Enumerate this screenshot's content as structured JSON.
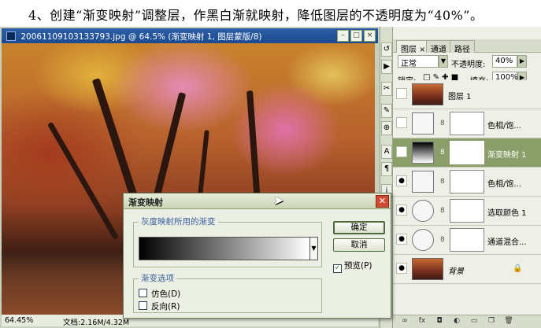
{
  "caption": "4、创建“渐变映射”调整层，作黑白渐就映射，降低图层的不透明度为“40%”。",
  "document": {
    "title": "20061109103133793.jpg @ 64.5% (渐变映射 1, 图层蒙版/8)",
    "zoom": "64.45%",
    "doc_size": "文档:2.16M/4.32M"
  },
  "layers_panel": {
    "tabs": [
      "图层",
      "通道",
      "路径"
    ],
    "blend_mode": "正常",
    "opacity_label": "不透明度:",
    "opacity_value": "40%",
    "lock_label": "锁定:",
    "fill_label": "填充:",
    "fill_value": "100%",
    "layers": [
      {
        "name": "图层 1",
        "kind": "photo",
        "visible": false,
        "selected": false
      },
      {
        "name": "色相/饱...",
        "kind": "adjust",
        "visible": false,
        "selected": false
      },
      {
        "name": "渐变映射 1",
        "kind": "gradient",
        "visible": true,
        "selected": true
      },
      {
        "name": "色相/饱...",
        "kind": "adjust",
        "visible": true,
        "selected": false
      },
      {
        "name": "选取颜色 1",
        "kind": "adjust",
        "visible": true,
        "selected": false
      },
      {
        "name": "通道混合...",
        "kind": "adjust",
        "visible": true,
        "selected": false
      },
      {
        "name": "背景",
        "kind": "photo",
        "visible": true,
        "selected": false
      }
    ]
  },
  "dialog": {
    "title": "渐变映射",
    "group1_title": "灰度映射所用的渐变",
    "group2_title": "渐变选项",
    "dither_label": "仿色(D)",
    "reverse_label": "反向(R)",
    "ok_label": "确定",
    "cancel_label": "取消",
    "preview_label": "预览(P)",
    "preview_checked": true,
    "dither_checked": false,
    "reverse_checked": false,
    "gradient_from": "#000000",
    "gradient_to": "#ffffff"
  }
}
